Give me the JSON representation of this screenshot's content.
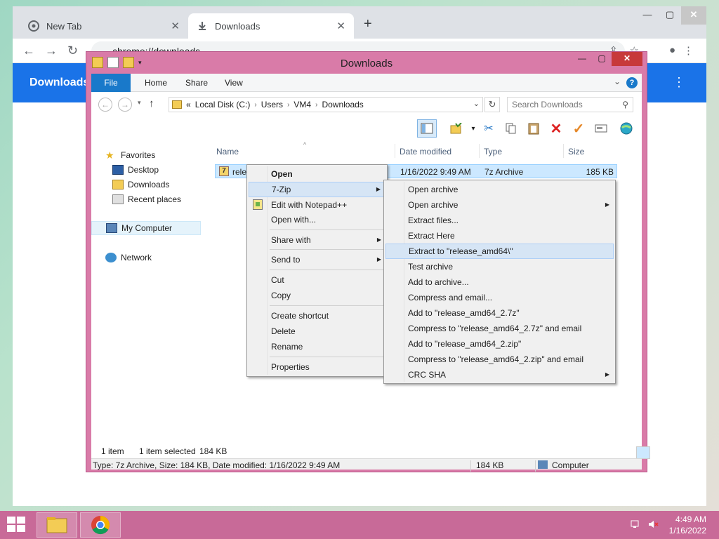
{
  "chrome": {
    "tabs": [
      {
        "label": "New Tab"
      },
      {
        "label": "Downloads"
      }
    ],
    "new_tab_label": "+",
    "address_scheme": "chrome",
    "address": "chrome://downloads",
    "page_title": "Downloads"
  },
  "explorer": {
    "title": "Downloads",
    "ribbon_tabs": [
      "File",
      "Home",
      "Share",
      "View"
    ],
    "breadcrumb_prefix": "«",
    "breadcrumb": [
      "Local Disk (C:)",
      "Users",
      "VM4",
      "Downloads"
    ],
    "search_placeholder": "Search Downloads",
    "nav": {
      "favorites": "Favorites",
      "desktop": "Desktop",
      "downloads": "Downloads",
      "recent": "Recent places",
      "computer": "My Computer",
      "network": "Network"
    },
    "columns": [
      "Name",
      "Date modified",
      "Type",
      "Size"
    ],
    "file": {
      "name": "relea",
      "date": "1/16/2022 9:49 AM",
      "type": "7z Archive",
      "size": "185 KB"
    },
    "status": {
      "count": "1 item",
      "selected": "1 item selected",
      "sel_size": "184 KB"
    },
    "details": {
      "info": "Type: 7z Archive, Size: 184 KB, Date modified: 1/16/2022 9:49 AM",
      "size": "184 KB",
      "location": "Computer"
    }
  },
  "context_menu": {
    "open": "Open",
    "sevenzip": "7-Zip",
    "notepad": "Edit with Notepad++",
    "open_with": "Open with...",
    "share_with": "Share with",
    "send_to": "Send to",
    "cut": "Cut",
    "copy": "Copy",
    "create_shortcut": "Create shortcut",
    "delete": "Delete",
    "rename": "Rename",
    "properties": "Properties"
  },
  "sevenzip_menu": [
    "Open archive",
    "Open archive",
    "Extract files...",
    "Extract Here",
    "Extract to \"release_amd64\\\"",
    "Test archive",
    "Add to archive...",
    "Compress and email...",
    "Add to \"release_amd64_2.7z\"",
    "Compress to \"release_amd64_2.7z\" and email",
    "Add to \"release_amd64_2.zip\"",
    "Compress to \"release_amd64_2.zip\" and email",
    "CRC SHA"
  ],
  "taskbar": {
    "time": "4:49 AM",
    "date": "1/16/2022"
  },
  "colors": {
    "accent": "#1a73e8",
    "explorer_frame": "#d97ba8",
    "taskbar": "#c86a98",
    "close_red": "#c7393a",
    "selection": "#cce8ff"
  }
}
